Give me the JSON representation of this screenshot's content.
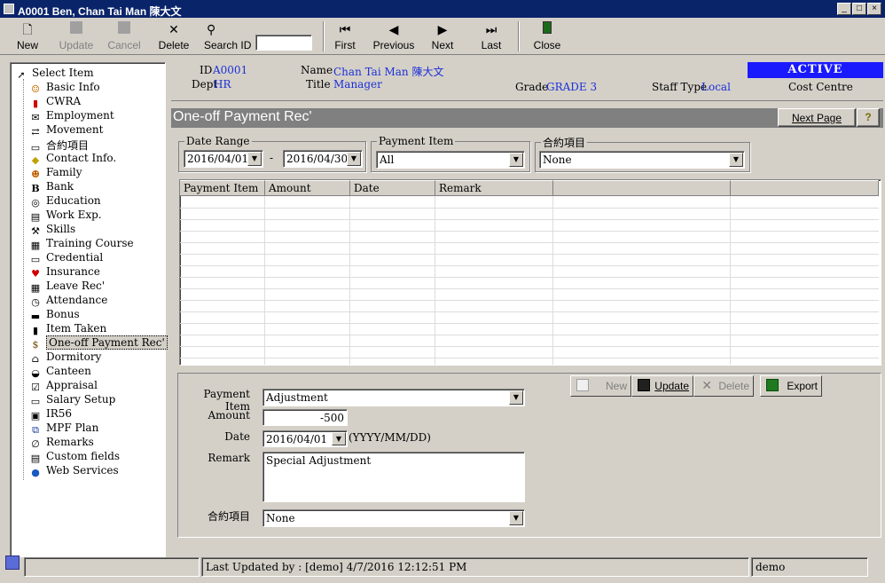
{
  "window": {
    "title": "A0001 Ben, Chan Tai Man 陳大文"
  },
  "toolbar": {
    "new": "New",
    "update": "Update",
    "cancel": "Cancel",
    "delete": "Delete",
    "search_label": "Search ID",
    "search_value": "",
    "first": "First",
    "previous": "Previous",
    "next": "Next",
    "last": "Last",
    "close": "Close"
  },
  "tree": {
    "items": [
      {
        "label": "Select Item",
        "icon": "pointer-icon"
      },
      {
        "label": "Basic Info",
        "icon": "person-icon"
      },
      {
        "label": "CWRA",
        "icon": "flag-icon"
      },
      {
        "label": "Employment",
        "icon": "envelope-icon"
      },
      {
        "label": "Movement",
        "icon": "move-icon"
      },
      {
        "label": "合約項目",
        "icon": "folder-icon"
      },
      {
        "label": "Contact Info.",
        "icon": "diamond-icon"
      },
      {
        "label": "Family",
        "icon": "face-icon"
      },
      {
        "label": "Bank",
        "icon": "bold-b-icon"
      },
      {
        "label": "Education",
        "icon": "globe-icon"
      },
      {
        "label": "Work Exp.",
        "icon": "document-icon"
      },
      {
        "label": "Skills",
        "icon": "wrench-icon"
      },
      {
        "label": "Training Course",
        "icon": "chart-icon"
      },
      {
        "label": "Credential",
        "icon": "card-icon"
      },
      {
        "label": "Insurance",
        "icon": "heart-icon"
      },
      {
        "label": "Leave Rec'",
        "icon": "calendar-icon"
      },
      {
        "label": "Attendance",
        "icon": "clock-icon"
      },
      {
        "label": "Bonus",
        "icon": "money-icon"
      },
      {
        "label": "Item Taken",
        "icon": "item-icon"
      },
      {
        "label": "One-off Payment Rec'",
        "icon": "dollar-icon"
      },
      {
        "label": "Dormitory",
        "icon": "house-icon"
      },
      {
        "label": "Canteen",
        "icon": "bowl-icon"
      },
      {
        "label": "Appraisal",
        "icon": "checkbox-icon"
      },
      {
        "label": "Salary Setup",
        "icon": "keyboard-icon"
      },
      {
        "label": "IR56",
        "icon": "disk-icon"
      },
      {
        "label": "MPF Plan",
        "icon": "network-icon"
      },
      {
        "label": "Remarks",
        "icon": "paperclip-icon"
      },
      {
        "label": "Custom fields",
        "icon": "custom-icon"
      },
      {
        "label": "Web Services",
        "icon": "web-globe-icon"
      }
    ],
    "selected_index": 19
  },
  "header": {
    "id_label": "ID",
    "id_value": "A0001",
    "dept_label": "Dept",
    "dept_value": "HR",
    "name_label": "Name",
    "name_value": "Chan Tai Man 陳大文",
    "title_label": "Title",
    "title_value": "Manager",
    "grade_label": "Grade",
    "grade_value": "GRADE 3",
    "staff_type_label": "Staff Type",
    "staff_type_value": "Local",
    "status": "ACTIVE",
    "cost_centre_label": "Cost Centre"
  },
  "section": {
    "title": "One-off Payment Rec'",
    "next_page": "Next Page",
    "help": "?"
  },
  "filters": {
    "date_range_label": "Date Range",
    "date_from": "2016/04/01",
    "date_sep": "-",
    "date_to": "2016/04/30",
    "payment_item_label": "Payment Item",
    "payment_item_value": "All",
    "contract_label": "合約項目",
    "contract_value": "None"
  },
  "grid": {
    "columns": [
      "Payment Item",
      "Amount",
      "Date",
      "Remark",
      "",
      ""
    ]
  },
  "form": {
    "payment_item_label": "Payment Item",
    "payment_item_value": "Adjustment",
    "amount_label": "Amount",
    "amount_value": "-500",
    "date_label": "Date",
    "date_value": "2016/04/01",
    "date_hint": "(YYYY/MM/DD)",
    "remark_label": "Remark",
    "remark_value": "Special Adjustment",
    "contract_label": "合約項目",
    "contract_value": "None"
  },
  "actions": {
    "new": "New",
    "update": "Update",
    "delete": "Delete",
    "export": "Export"
  },
  "status_bar": {
    "last_updated": "Last Updated by : [demo]  4/7/2016 12:12:51 PM",
    "user": "demo"
  }
}
